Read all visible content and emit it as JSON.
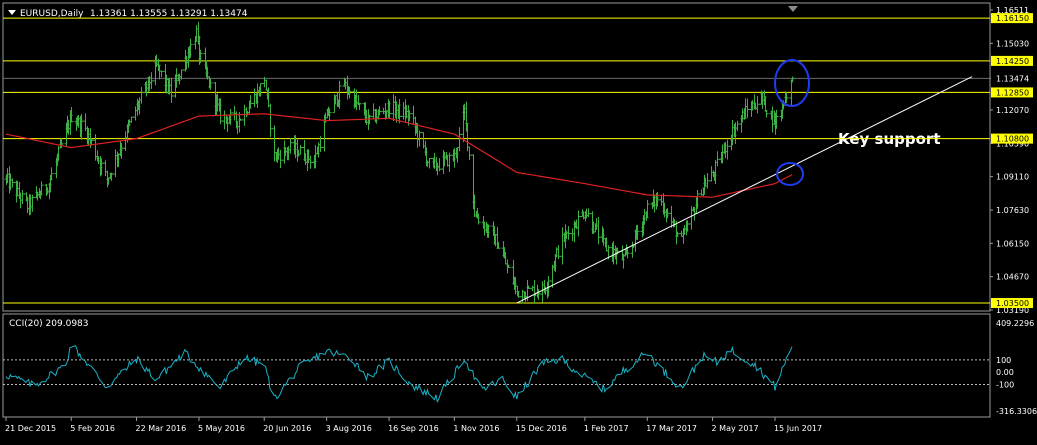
{
  "header": {
    "symbol_label": "EURUSD,Daily",
    "ohlc_label": "1.13361 1.13555 1.13291 1.13474"
  },
  "chart_data": [
    {
      "type": "bar",
      "subtype": "ohlc",
      "symbol": "EURUSD",
      "timeframe": "Daily",
      "last_bar": {
        "open": 1.13361,
        "high": 1.13555,
        "low": 1.13291,
        "close": 1.13474
      },
      "ylim": [
        1.0319,
        1.1651
      ],
      "y_ticks": [
        "1.16511",
        "1.15030",
        "1.13474",
        "1.12070",
        "1.10590",
        "1.09110",
        "1.07630",
        "1.06150",
        "1.04670",
        "1.03190"
      ],
      "x_ticks": [
        "21 Dec 2015",
        "5 Feb 2016",
        "22 Mar 2016",
        "5 May 2016",
        "20 Jun 2016",
        "3 Aug 2016",
        "16 Sep 2016",
        "1 Nov 2016",
        "15 Dec 2016",
        "1 Feb 2017",
        "17 Mar 2017",
        "2 May 2017",
        "15 Jun 2017"
      ],
      "bars_color": "#3cb043",
      "moving_average_color": "#dd2222",
      "horizontal_levels": [
        {
          "label": "1.16150",
          "value": 1.1615
        },
        {
          "label": "1.14250",
          "value": 1.1425
        },
        {
          "label": "1.12850",
          "value": 1.1285
        },
        {
          "label": "1.10800",
          "value": 1.108
        },
        {
          "label": "1.03500",
          "value": 1.035
        }
      ],
      "current_price": {
        "label": "1.13474",
        "value": 1.13474
      },
      "level_color": "#ffff00",
      "annotation": "Key support",
      "trendline": {
        "from": [
          "15 Dec 2016",
          1.035
        ],
        "to": [
          "15 Jun 2017",
          1.092
        ]
      },
      "series_keypoints": [
        {
          "date": "21 Dec 2015",
          "close": 1.09
        },
        {
          "date": "5 Jan 2016",
          "close": 1.078
        },
        {
          "date": "20 Jan 2016",
          "close": 1.088
        },
        {
          "date": "5 Feb 2016",
          "close": 1.118
        },
        {
          "date": "15 Feb 2016",
          "close": 1.112
        },
        {
          "date": "1 Mar 2016",
          "close": 1.09
        },
        {
          "date": "22 Mar 2016",
          "close": 1.122
        },
        {
          "date": "5 Apr 2016",
          "close": 1.14
        },
        {
          "date": "15 Apr 2016",
          "close": 1.128
        },
        {
          "date": "3 May 2016",
          "close": 1.155
        },
        {
          "date": "5 May 2016",
          "close": 1.145
        },
        {
          "date": "20 May 2016",
          "close": 1.118
        },
        {
          "date": "1 Jun 2016",
          "close": 1.116
        },
        {
          "date": "15 Jun 2016",
          "close": 1.128
        },
        {
          "date": "20 Jun 2016",
          "close": 1.135
        },
        {
          "date": "27 Jun 2016",
          "close": 1.1
        },
        {
          "date": "10 Jul 2016",
          "close": 1.104
        },
        {
          "date": "25 Jul 2016",
          "close": 1.098
        },
        {
          "date": "3 Aug 2016",
          "close": 1.118
        },
        {
          "date": "15 Aug 2016",
          "close": 1.132
        },
        {
          "date": "1 Sep 2016",
          "close": 1.116
        },
        {
          "date": "16 Sep 2016",
          "close": 1.122
        },
        {
          "date": "1 Oct 2016",
          "close": 1.118
        },
        {
          "date": "15 Oct 2016",
          "close": 1.095
        },
        {
          "date": "1 Nov 2016",
          "close": 1.1
        },
        {
          "date": "8 Nov 2016",
          "close": 1.12
        },
        {
          "date": "15 Nov 2016",
          "close": 1.075
        },
        {
          "date": "1 Dec 2016",
          "close": 1.062
        },
        {
          "date": "15 Dec 2016",
          "close": 1.04
        },
        {
          "date": "3 Jan 2017",
          "close": 1.041
        },
        {
          "date": "15 Jan 2017",
          "close": 1.062
        },
        {
          "date": "1 Feb 2017",
          "close": 1.076
        },
        {
          "date": "15 Feb 2017",
          "close": 1.06
        },
        {
          "date": "1 Mar 2017",
          "close": 1.054
        },
        {
          "date": "17 Mar 2017",
          "close": 1.077
        },
        {
          "date": "25 Mar 2017",
          "close": 1.082
        },
        {
          "date": "10 Apr 2017",
          "close": 1.062
        },
        {
          "date": "24 Apr 2017",
          "close": 1.086
        },
        {
          "date": "2 May 2017",
          "close": 1.092
        },
        {
          "date": "15 May 2017",
          "close": 1.11
        },
        {
          "date": "25 May 2017",
          "close": 1.12
        },
        {
          "date": "5 Jun 2017",
          "close": 1.126
        },
        {
          "date": "15 Jun 2017",
          "close": 1.115
        },
        {
          "date": "27 Jun 2017",
          "close": 1.13474
        }
      ],
      "moving_average_keypoints": [
        {
          "date": "21 Dec 2015",
          "value": 1.11
        },
        {
          "date": "5 Feb 2016",
          "value": 1.104
        },
        {
          "date": "22 Mar 2016",
          "value": 1.108
        },
        {
          "date": "5 May 2016",
          "value": 1.118
        },
        {
          "date": "20 Jun 2016",
          "value": 1.119
        },
        {
          "date": "3 Aug 2016",
          "value": 1.116
        },
        {
          "date": "16 Sep 2016",
          "value": 1.117
        },
        {
          "date": "1 Nov 2016",
          "value": 1.11
        },
        {
          "date": "15 Dec 2016",
          "value": 1.093
        },
        {
          "date": "1 Feb 2017",
          "value": 1.088
        },
        {
          "date": "17 Mar 2017",
          "value": 1.083
        },
        {
          "date": "2 May 2017",
          "value": 1.082
        },
        {
          "date": "15 Jun 2017",
          "value": 1.088
        },
        {
          "date": "27 Jun 2017",
          "value": 1.092
        }
      ]
    },
    {
      "type": "line",
      "indicator_label": "CCI(20) 209.0983",
      "ylim": [
        -316.3306,
        409.2296
      ],
      "y_ticks": [
        "409.2296",
        "100",
        "0.00",
        "-100",
        "-316.3306"
      ],
      "reference_levels": [
        100,
        -100
      ],
      "line_color": "#19b3c6",
      "keypoints": [
        {
          "date": "21 Dec 2015",
          "value": -20
        },
        {
          "date": "10 Jan 2016",
          "value": -110
        },
        {
          "date": "1 Feb 2016",
          "value": 60
        },
        {
          "date": "5 Feb 2016",
          "value": 230
        },
        {
          "date": "15 Feb 2016",
          "value": 90
        },
        {
          "date": "1 Mar 2016",
          "value": -120
        },
        {
          "date": "22 Mar 2016",
          "value": 110
        },
        {
          "date": "5 Apr 2016",
          "value": -60
        },
        {
          "date": "25 Apr 2016",
          "value": 160
        },
        {
          "date": "5 May 2016",
          "value": 40
        },
        {
          "date": "20 May 2016",
          "value": -130
        },
        {
          "date": "5 Jun 2016",
          "value": 120
        },
        {
          "date": "20 Jun 2016",
          "value": 60
        },
        {
          "date": "27 Jun 2016",
          "value": -220
        },
        {
          "date": "15 Jul 2016",
          "value": 40
        },
        {
          "date": "3 Aug 2016",
          "value": 170
        },
        {
          "date": "20 Aug 2016",
          "value": 120
        },
        {
          "date": "1 Sep 2016",
          "value": -40
        },
        {
          "date": "16 Sep 2016",
          "value": 90
        },
        {
          "date": "1 Oct 2016",
          "value": -100
        },
        {
          "date": "20 Oct 2016",
          "value": -210
        },
        {
          "date": "1 Nov 2016",
          "value": -20
        },
        {
          "date": "8 Nov 2016",
          "value": 120
        },
        {
          "date": "20 Nov 2016",
          "value": -150
        },
        {
          "date": "5 Dec 2016",
          "value": -60
        },
        {
          "date": "15 Dec 2016",
          "value": -210
        },
        {
          "date": "1 Jan 2017",
          "value": 60
        },
        {
          "date": "15 Jan 2017",
          "value": 110
        },
        {
          "date": "1 Feb 2017",
          "value": -40
        },
        {
          "date": "15 Feb 2017",
          "value": -140
        },
        {
          "date": "1 Mar 2017",
          "value": 20
        },
        {
          "date": "17 Mar 2017",
          "value": 160
        },
        {
          "date": "25 Mar 2017",
          "value": 50
        },
        {
          "date": "10 Apr 2017",
          "value": -130
        },
        {
          "date": "25 Apr 2017",
          "value": 130
        },
        {
          "date": "5 May 2017",
          "value": 80
        },
        {
          "date": "15 May 2017",
          "value": 180
        },
        {
          "date": "1 Jun 2017",
          "value": 60
        },
        {
          "date": "15 Jun 2017",
          "value": -120
        },
        {
          "date": "27 Jun 2017",
          "value": 209.0983
        }
      ]
    }
  ]
}
